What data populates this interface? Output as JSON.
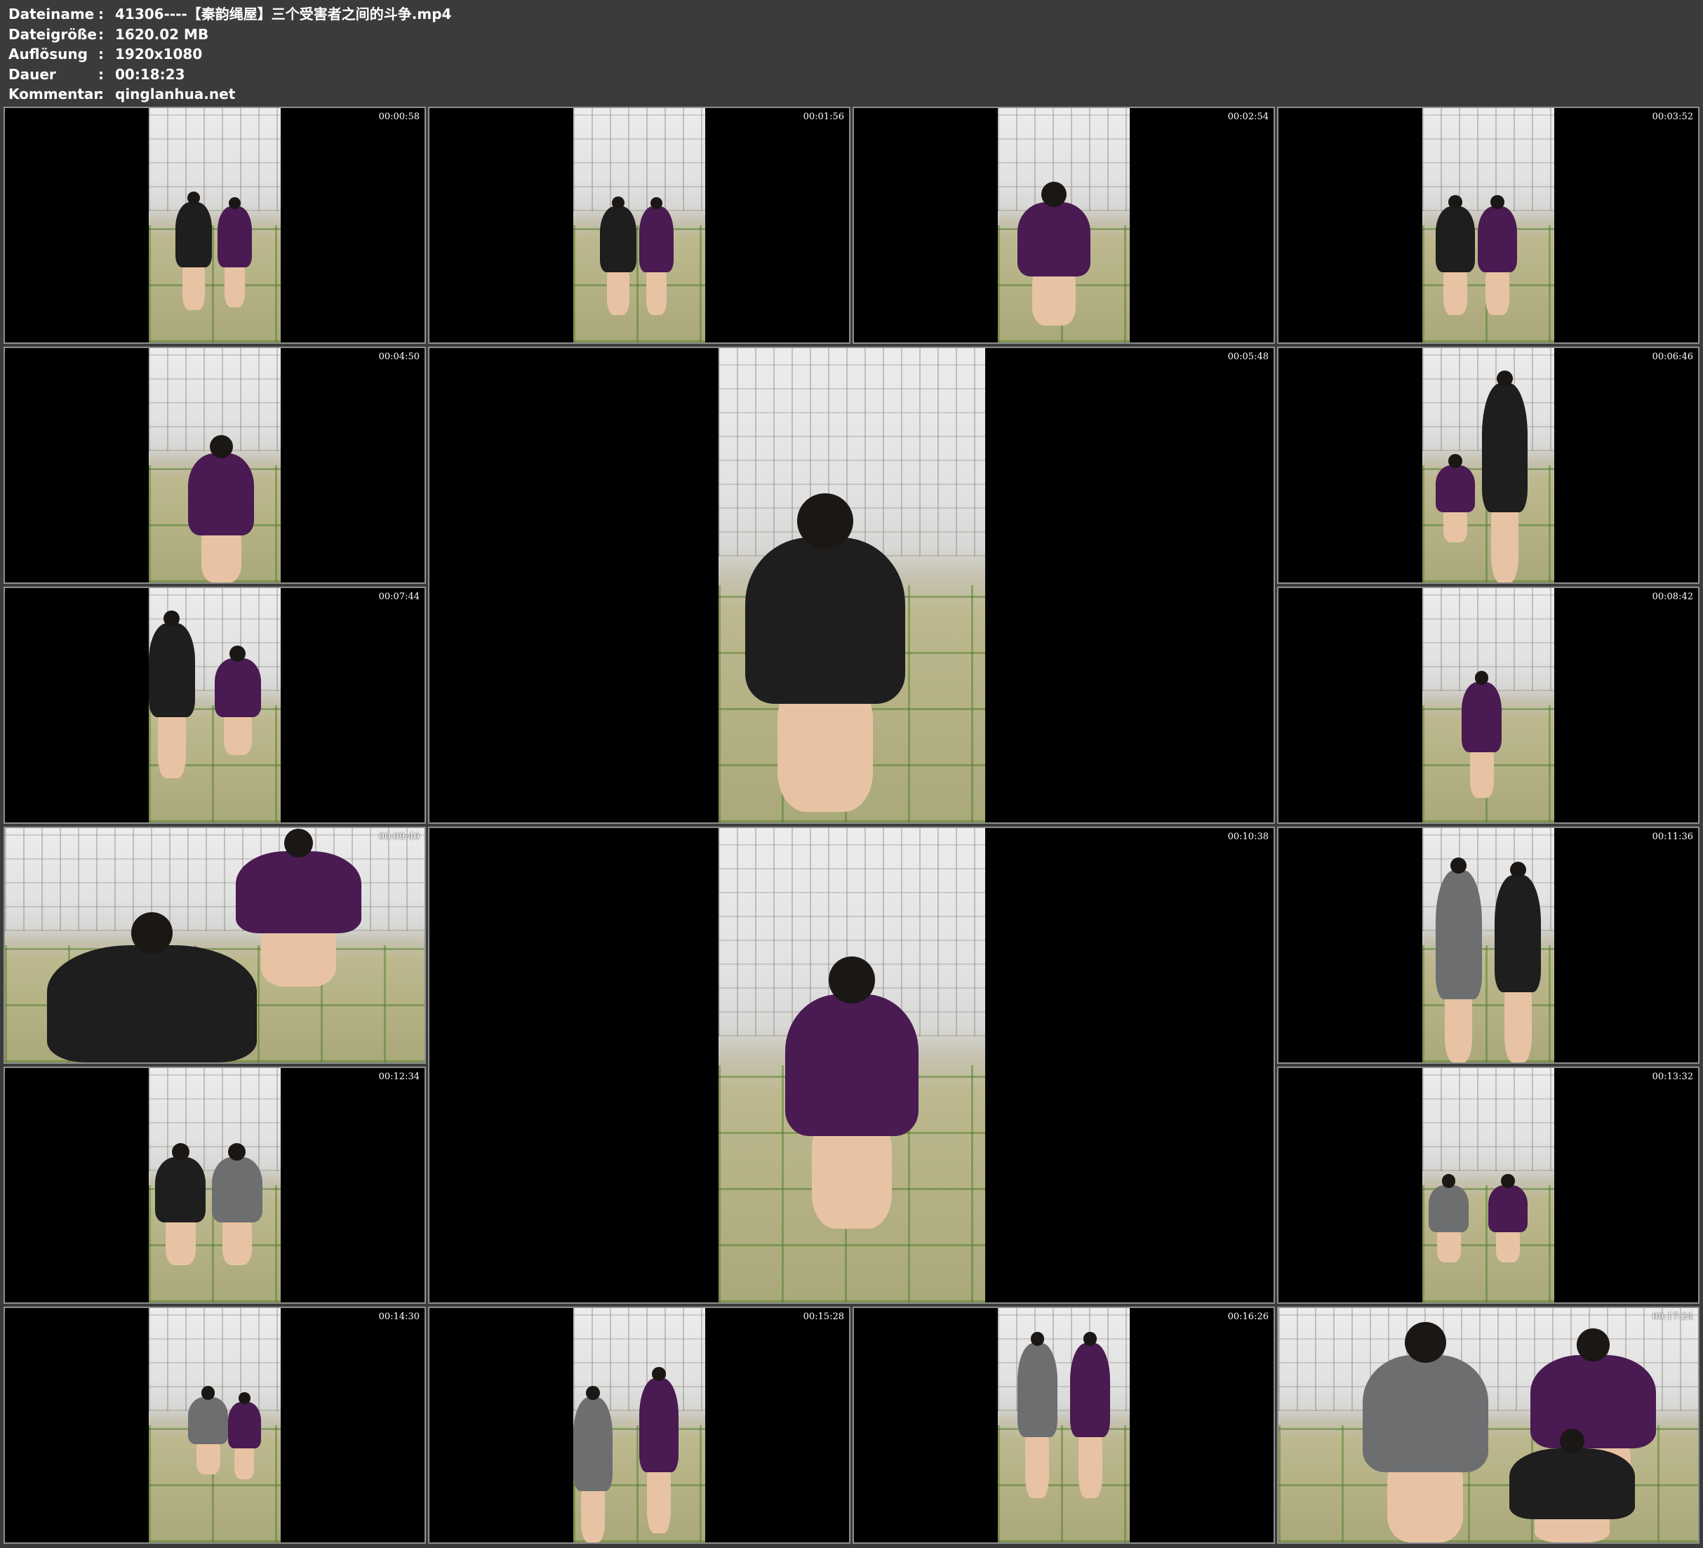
{
  "info": [
    {
      "key": "Dateiname",
      "value": "41306----【秦韵绳屋】三个受害者之间的斗争.mp4"
    },
    {
      "key": "Dateigröße",
      "value": "1620.02 MB"
    },
    {
      "key": "Auflösung",
      "value": "1920x1080"
    },
    {
      "key": "Dauer",
      "value": "00:18:23"
    },
    {
      "key": "Kommentar",
      "value": "qinglanhua.net"
    }
  ],
  "separator": ":",
  "thumbnails": [
    {
      "timestamp": "00:00:58"
    },
    {
      "timestamp": "00:01:56"
    },
    {
      "timestamp": "00:02:54"
    },
    {
      "timestamp": "00:03:52"
    },
    {
      "timestamp": "00:04:50"
    },
    {
      "timestamp": "00:05:48"
    },
    {
      "timestamp": "00:06:46"
    },
    {
      "timestamp": "00:07:44"
    },
    {
      "timestamp": "00:08:42"
    },
    {
      "timestamp": "00:09:40"
    },
    {
      "timestamp": "00:10:38"
    },
    {
      "timestamp": "00:11:36"
    },
    {
      "timestamp": "00:12:34"
    },
    {
      "timestamp": "00:13:32"
    },
    {
      "timestamp": "00:14:30"
    },
    {
      "timestamp": "00:15:28"
    },
    {
      "timestamp": "00:16:26"
    },
    {
      "timestamp": "00:17:24"
    }
  ],
  "colors": {
    "background": "#3b3b3b",
    "border": "#8e8e8e",
    "text": "#ffffff",
    "purple_dress": "#4a1a52",
    "black_dress": "#1e1e1e",
    "grey_dress": "#6c6e70"
  }
}
